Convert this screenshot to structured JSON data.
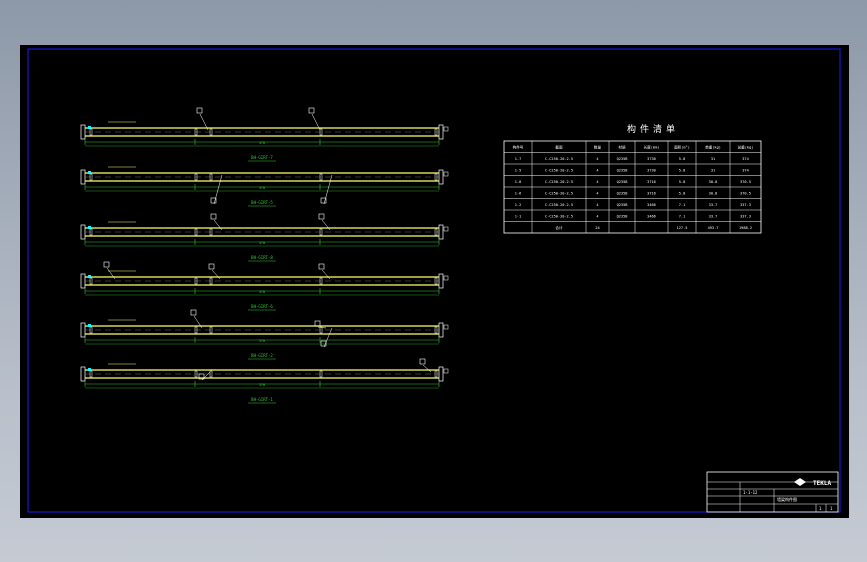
{
  "drawing": {
    "frame_color": "#1a1aff",
    "beam_color": "#ffff66",
    "dim_color": "#33cc33",
    "tag_color": "#ffffff",
    "marker_color": "#00ffff",
    "beams": [
      {
        "label": "BH-GIRT-7",
        "span": "370"
      },
      {
        "label": "BH-GIRT-5",
        "span": "370"
      },
      {
        "label": "BH-GIRT-8",
        "span": "370"
      },
      {
        "label": "BH-GIRT-6",
        "span": "370"
      },
      {
        "label": "BH-GIRT-2",
        "span": "370"
      },
      {
        "label": "BH-GIRT-1",
        "span": "370"
      }
    ]
  },
  "schedule": {
    "title": "构件清单",
    "headers": [
      "构件号",
      "截面",
      "数量",
      "材质",
      "长度(mm)",
      "面积(m²)",
      "单重(kg)",
      "总重(kg)"
    ],
    "rows": [
      [
        "1-7",
        "C-C250-20-2.5",
        "4",
        "Q235B",
        "3730",
        "5.8",
        "31",
        "374"
      ],
      [
        "1-5",
        "C-C250-20-2.5",
        "4",
        "Q235B",
        "3730",
        "5.8",
        "31",
        "374"
      ],
      [
        "1-8",
        "C-C250-20-2.5",
        "4",
        "Q235B",
        "3716",
        "5.8",
        "30.8",
        "370.5"
      ],
      [
        "1-6",
        "C-C250-20-2.5",
        "4",
        "Q235B",
        "3716",
        "5.8",
        "30.8",
        "370.5"
      ],
      [
        "1-2",
        "C-C250-20-2.5",
        "4",
        "Q235B",
        "3466",
        "7.1",
        "33.7",
        "337.3"
      ],
      [
        "1-1",
        "C-C250-20-2.5",
        "4",
        "Q235B",
        "3466",
        "7.1",
        "33.7",
        "337.3"
      ]
    ],
    "total": [
      "",
      "合计",
      "24",
      "",
      "",
      "127.5",
      "493.7",
      "1988.2"
    ]
  },
  "title_block": {
    "company": "TEKLA",
    "project_no": "1-1-12",
    "drawing_name": "墙梁构件图",
    "sheet_no": "1",
    "sheet_total": "1"
  }
}
